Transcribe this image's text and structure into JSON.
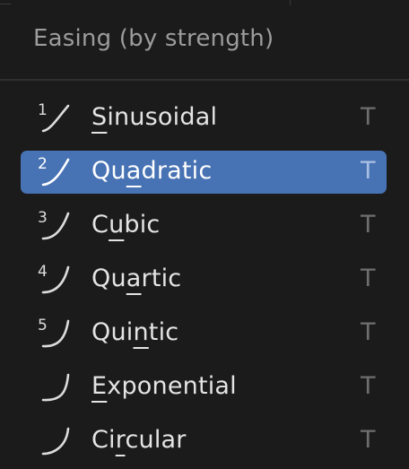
{
  "menu": {
    "title": "Easing (by strength)",
    "items": [
      {
        "label": "Sinusoidal",
        "mnemonic_index": 0,
        "shortcut": "T",
        "icon_number": "1",
        "icon": "ease-sine-icon",
        "active": false
      },
      {
        "label": "Quadratic",
        "mnemonic_index": 2,
        "shortcut": "T",
        "icon_number": "2",
        "icon": "ease-quad-icon",
        "active": true
      },
      {
        "label": "Cubic",
        "mnemonic_index": 1,
        "shortcut": "T",
        "icon_number": "3",
        "icon": "ease-cubic-icon",
        "active": false
      },
      {
        "label": "Quartic",
        "mnemonic_index": 2,
        "shortcut": "T",
        "icon_number": "4",
        "icon": "ease-quart-icon",
        "active": false
      },
      {
        "label": "Quintic",
        "mnemonic_index": 3,
        "shortcut": "T",
        "icon_number": "5",
        "icon": "ease-quint-icon",
        "active": false
      },
      {
        "label": "Exponential",
        "mnemonic_index": 0,
        "shortcut": "T",
        "icon_number": "",
        "icon": "ease-expo-icon",
        "active": false
      },
      {
        "label": "Circular",
        "mnemonic_index": 2,
        "shortcut": "T",
        "icon_number": "",
        "icon": "ease-circ-icon",
        "active": false
      }
    ]
  },
  "colors": {
    "background": "#1b1b1b",
    "highlight": "#4772b3",
    "text": "#e4e4e4",
    "muted": "#9c9c9c",
    "shortcut": "#6f6f6f"
  }
}
